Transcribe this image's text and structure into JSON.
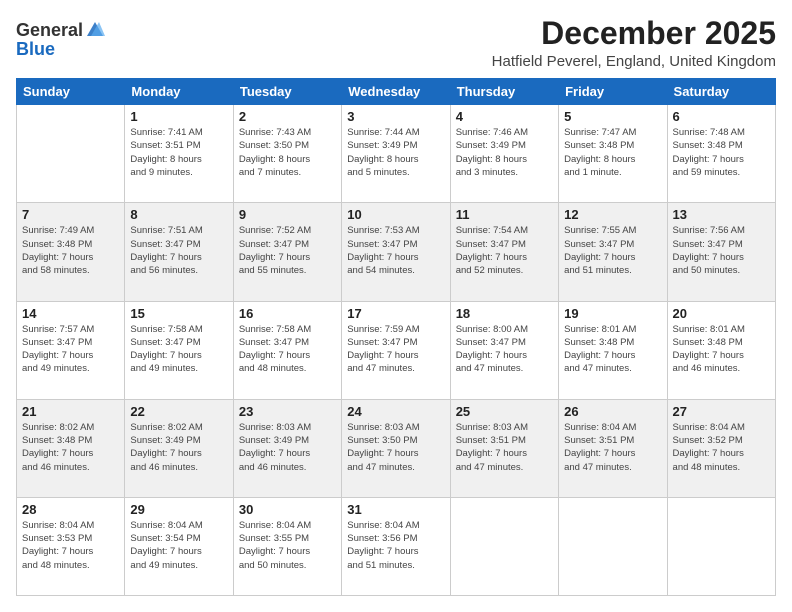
{
  "header": {
    "logo_line1": "General",
    "logo_line2": "Blue",
    "month_title": "December 2025",
    "subtitle": "Hatfield Peverel, England, United Kingdom"
  },
  "days_of_week": [
    "Sunday",
    "Monday",
    "Tuesday",
    "Wednesday",
    "Thursday",
    "Friday",
    "Saturday"
  ],
  "weeks": [
    [
      {
        "day": "",
        "info": ""
      },
      {
        "day": "1",
        "info": "Sunrise: 7:41 AM\nSunset: 3:51 PM\nDaylight: 8 hours\nand 9 minutes."
      },
      {
        "day": "2",
        "info": "Sunrise: 7:43 AM\nSunset: 3:50 PM\nDaylight: 8 hours\nand 7 minutes."
      },
      {
        "day": "3",
        "info": "Sunrise: 7:44 AM\nSunset: 3:49 PM\nDaylight: 8 hours\nand 5 minutes."
      },
      {
        "day": "4",
        "info": "Sunrise: 7:46 AM\nSunset: 3:49 PM\nDaylight: 8 hours\nand 3 minutes."
      },
      {
        "day": "5",
        "info": "Sunrise: 7:47 AM\nSunset: 3:48 PM\nDaylight: 8 hours\nand 1 minute."
      },
      {
        "day": "6",
        "info": "Sunrise: 7:48 AM\nSunset: 3:48 PM\nDaylight: 7 hours\nand 59 minutes."
      }
    ],
    [
      {
        "day": "7",
        "info": "Sunrise: 7:49 AM\nSunset: 3:48 PM\nDaylight: 7 hours\nand 58 minutes."
      },
      {
        "day": "8",
        "info": "Sunrise: 7:51 AM\nSunset: 3:47 PM\nDaylight: 7 hours\nand 56 minutes."
      },
      {
        "day": "9",
        "info": "Sunrise: 7:52 AM\nSunset: 3:47 PM\nDaylight: 7 hours\nand 55 minutes."
      },
      {
        "day": "10",
        "info": "Sunrise: 7:53 AM\nSunset: 3:47 PM\nDaylight: 7 hours\nand 54 minutes."
      },
      {
        "day": "11",
        "info": "Sunrise: 7:54 AM\nSunset: 3:47 PM\nDaylight: 7 hours\nand 52 minutes."
      },
      {
        "day": "12",
        "info": "Sunrise: 7:55 AM\nSunset: 3:47 PM\nDaylight: 7 hours\nand 51 minutes."
      },
      {
        "day": "13",
        "info": "Sunrise: 7:56 AM\nSunset: 3:47 PM\nDaylight: 7 hours\nand 50 minutes."
      }
    ],
    [
      {
        "day": "14",
        "info": "Sunrise: 7:57 AM\nSunset: 3:47 PM\nDaylight: 7 hours\nand 49 minutes."
      },
      {
        "day": "15",
        "info": "Sunrise: 7:58 AM\nSunset: 3:47 PM\nDaylight: 7 hours\nand 49 minutes."
      },
      {
        "day": "16",
        "info": "Sunrise: 7:58 AM\nSunset: 3:47 PM\nDaylight: 7 hours\nand 48 minutes."
      },
      {
        "day": "17",
        "info": "Sunrise: 7:59 AM\nSunset: 3:47 PM\nDaylight: 7 hours\nand 47 minutes."
      },
      {
        "day": "18",
        "info": "Sunrise: 8:00 AM\nSunset: 3:47 PM\nDaylight: 7 hours\nand 47 minutes."
      },
      {
        "day": "19",
        "info": "Sunrise: 8:01 AM\nSunset: 3:48 PM\nDaylight: 7 hours\nand 47 minutes."
      },
      {
        "day": "20",
        "info": "Sunrise: 8:01 AM\nSunset: 3:48 PM\nDaylight: 7 hours\nand 46 minutes."
      }
    ],
    [
      {
        "day": "21",
        "info": "Sunrise: 8:02 AM\nSunset: 3:48 PM\nDaylight: 7 hours\nand 46 minutes."
      },
      {
        "day": "22",
        "info": "Sunrise: 8:02 AM\nSunset: 3:49 PM\nDaylight: 7 hours\nand 46 minutes."
      },
      {
        "day": "23",
        "info": "Sunrise: 8:03 AM\nSunset: 3:49 PM\nDaylight: 7 hours\nand 46 minutes."
      },
      {
        "day": "24",
        "info": "Sunrise: 8:03 AM\nSunset: 3:50 PM\nDaylight: 7 hours\nand 47 minutes."
      },
      {
        "day": "25",
        "info": "Sunrise: 8:03 AM\nSunset: 3:51 PM\nDaylight: 7 hours\nand 47 minutes."
      },
      {
        "day": "26",
        "info": "Sunrise: 8:04 AM\nSunset: 3:51 PM\nDaylight: 7 hours\nand 47 minutes."
      },
      {
        "day": "27",
        "info": "Sunrise: 8:04 AM\nSunset: 3:52 PM\nDaylight: 7 hours\nand 48 minutes."
      }
    ],
    [
      {
        "day": "28",
        "info": "Sunrise: 8:04 AM\nSunset: 3:53 PM\nDaylight: 7 hours\nand 48 minutes."
      },
      {
        "day": "29",
        "info": "Sunrise: 8:04 AM\nSunset: 3:54 PM\nDaylight: 7 hours\nand 49 minutes."
      },
      {
        "day": "30",
        "info": "Sunrise: 8:04 AM\nSunset: 3:55 PM\nDaylight: 7 hours\nand 50 minutes."
      },
      {
        "day": "31",
        "info": "Sunrise: 8:04 AM\nSunset: 3:56 PM\nDaylight: 7 hours\nand 51 minutes."
      },
      {
        "day": "",
        "info": ""
      },
      {
        "day": "",
        "info": ""
      },
      {
        "day": "",
        "info": ""
      }
    ]
  ]
}
